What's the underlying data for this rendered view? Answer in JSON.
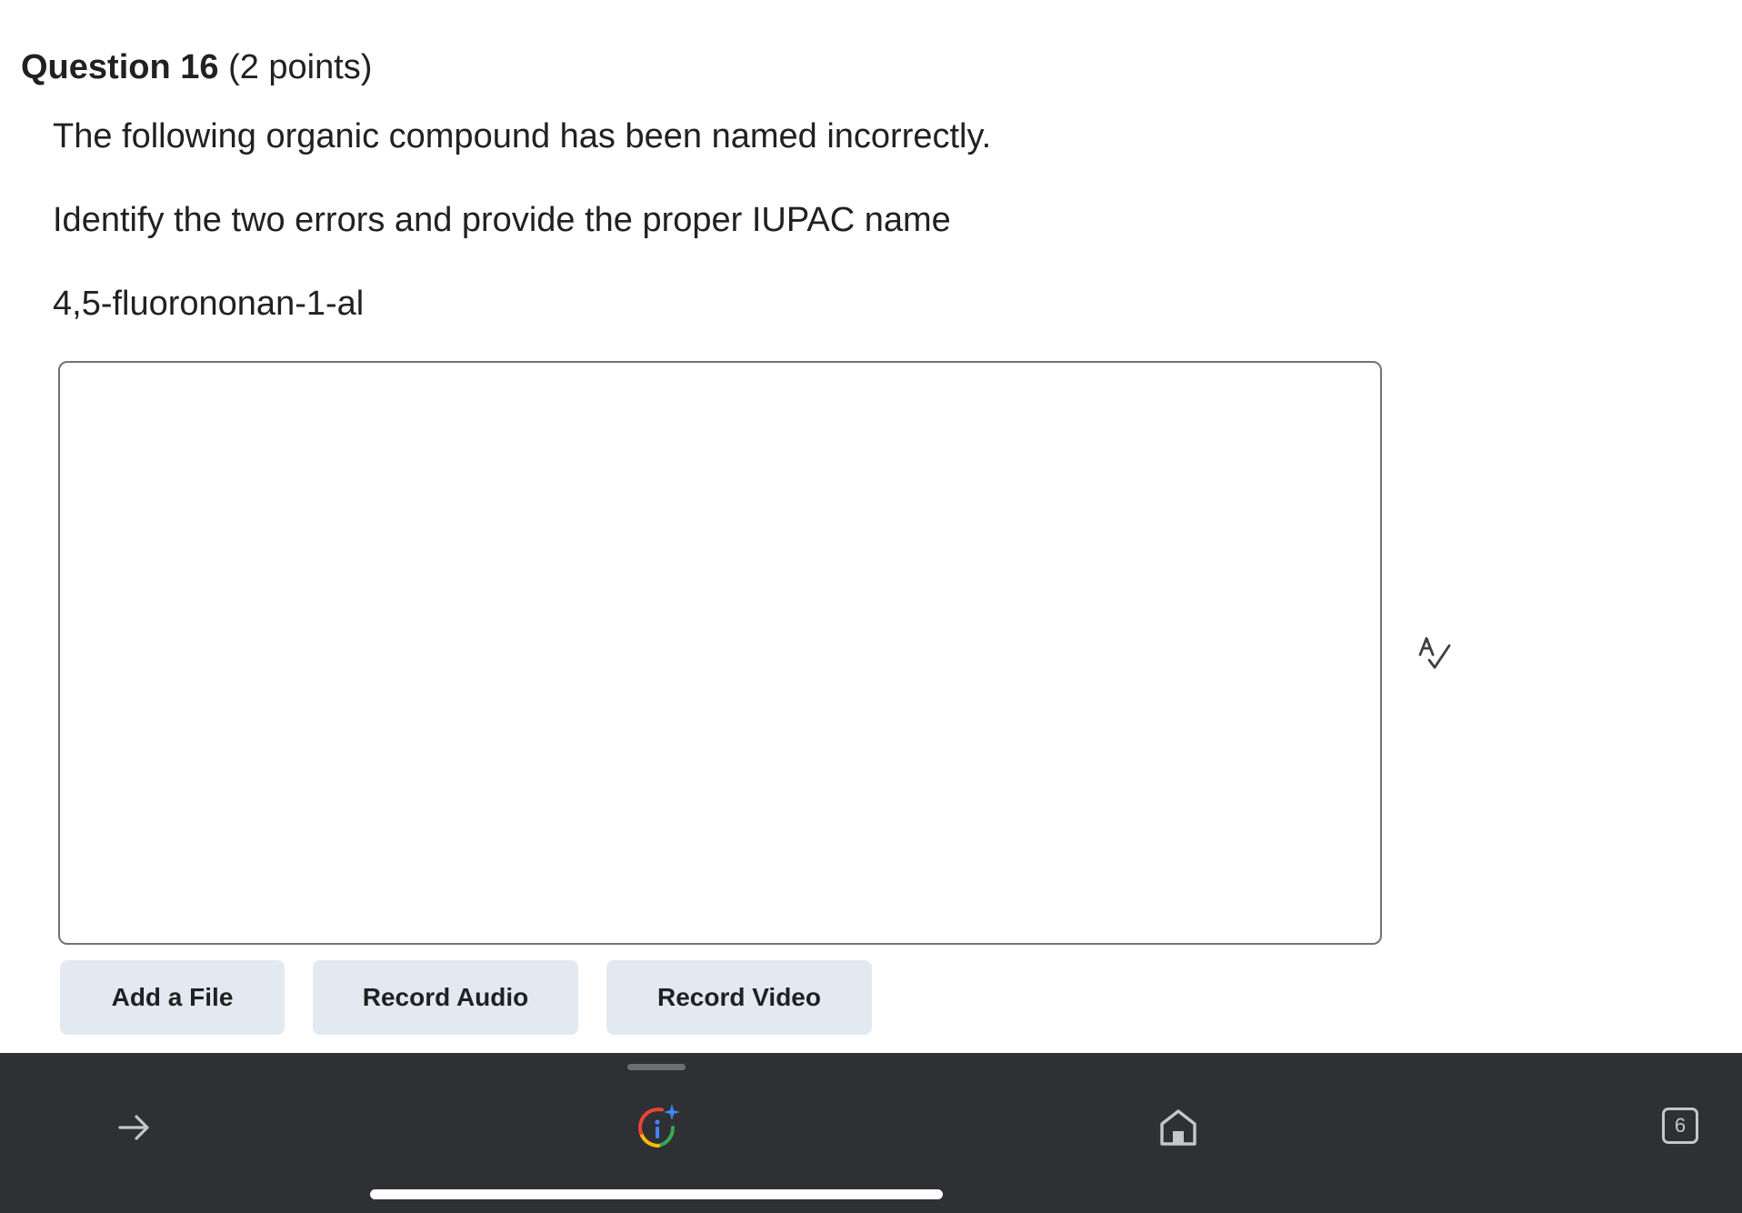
{
  "question": {
    "title": "Question 16",
    "points": "(2 points)",
    "lines": [
      "The following organic compound has been named incorrectly.",
      "Identify the two errors and provide the proper IUPAC name",
      "4,5-fluorononan-1-al"
    ]
  },
  "answer": {
    "value": "",
    "placeholder": ""
  },
  "buttons": {
    "add_file": "Add a File",
    "record_audio": "Record Audio",
    "record_video": "Record Video"
  },
  "nav_bar": {
    "tab_count": "6",
    "icons": [
      "arrow-forward-icon",
      "google-lens-icon",
      "home-icon",
      "tab-switcher-icon"
    ]
  },
  "colors": {
    "button_bg": "#e3e9f1",
    "nav_bg": "#2f3034",
    "text": "#202122"
  }
}
